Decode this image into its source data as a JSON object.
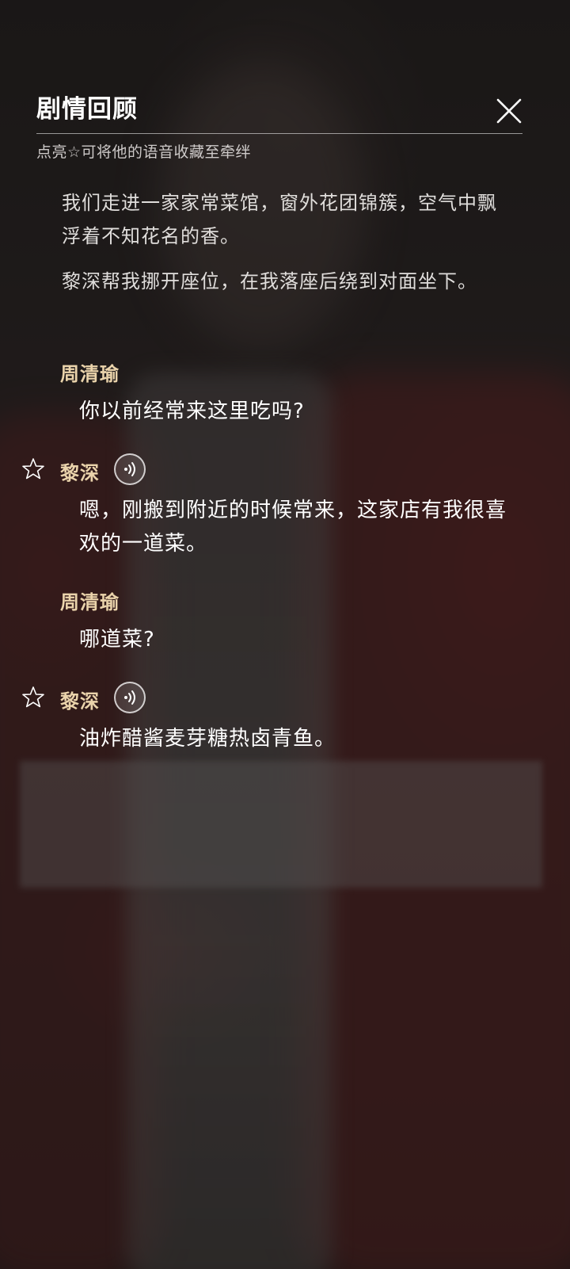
{
  "header": {
    "title": "剧情回顾",
    "hint": "点亮☆可将他的语音收藏至牵绊",
    "close_icon": "close-icon"
  },
  "narration": [
    "我们走进一家家常菜馆，窗外花团锦簇，空气中飘浮着不知花名的香。",
    "黎深帮我挪开座位，在我落座后绕到对面坐下。"
  ],
  "dialogues": [
    {
      "speaker": "周清瑜",
      "text": "你以前经常来这里吃吗?",
      "has_star": false,
      "has_voice": false
    },
    {
      "speaker": "黎深",
      "text": "嗯，刚搬到附近的时候常来，这家店有我很喜欢的一道菜。",
      "has_star": true,
      "has_voice": true
    },
    {
      "speaker": "周清瑜",
      "text": "哪道菜?",
      "has_star": false,
      "has_voice": false
    },
    {
      "speaker": "黎深",
      "text": "油炸醋酱麦芽糖热卤青鱼。",
      "has_star": true,
      "has_voice": true
    }
  ],
  "colors": {
    "speaker_name": "#ead3ab",
    "text": "#ffffff",
    "divider": "#ffffff"
  },
  "icons": {
    "favorite": "star-outline-icon",
    "voice": "voice-play-icon"
  }
}
